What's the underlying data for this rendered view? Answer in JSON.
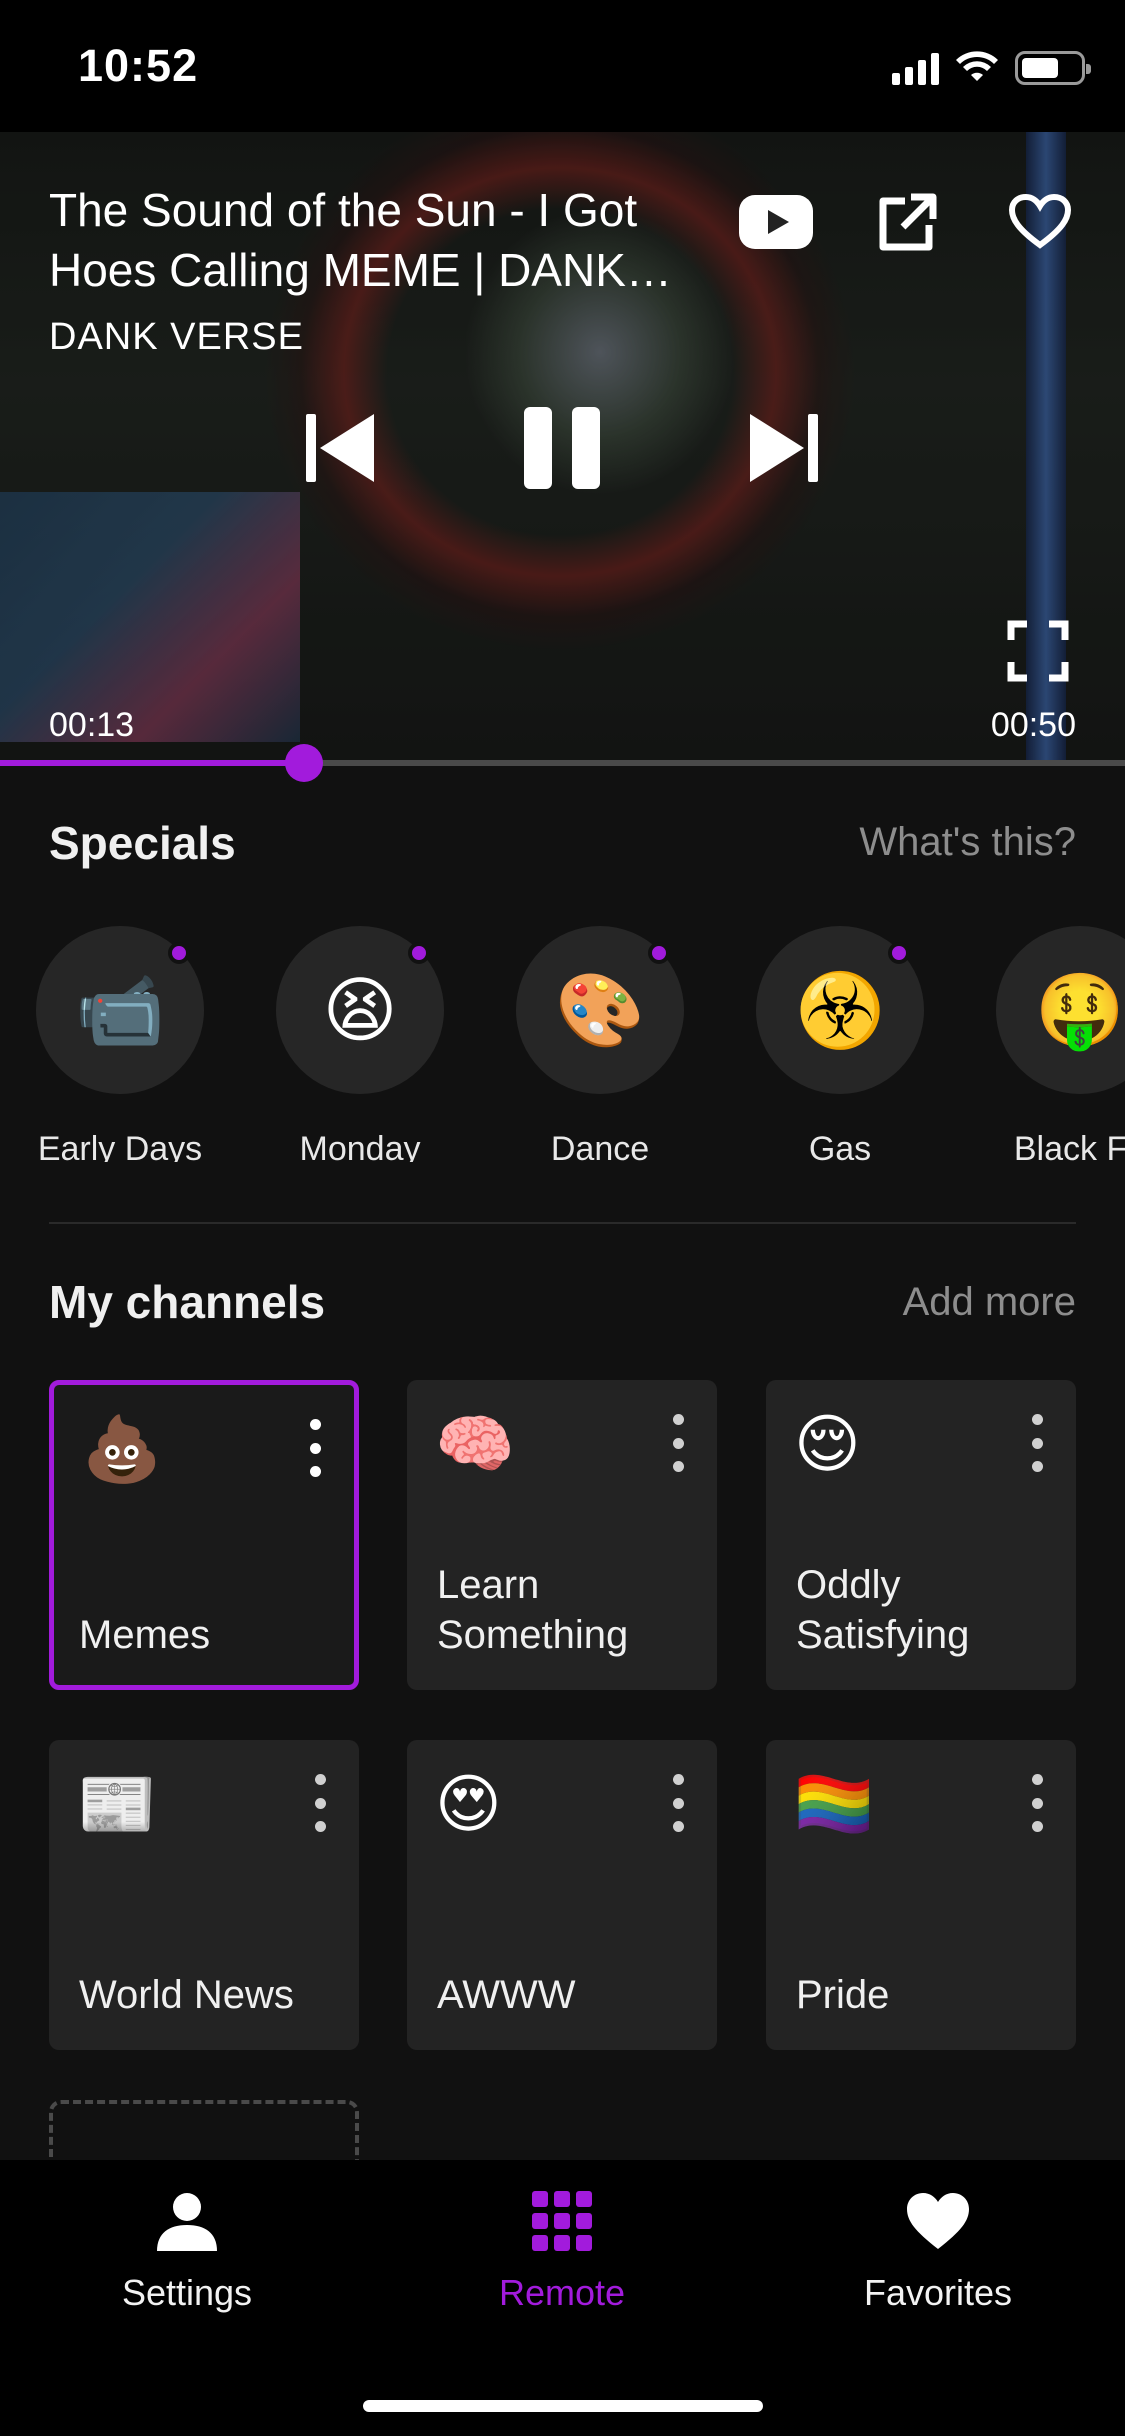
{
  "status_bar": {
    "time": "10:52"
  },
  "player": {
    "title": "The Sound of the Sun - I Got Hoes Calling MEME | DANK VERSE",
    "channel": "DANK VERSE",
    "current_time": "00:13",
    "duration": "00:50",
    "progress_fraction": 0.27
  },
  "specials": {
    "title": "Specials",
    "link": "What's this?",
    "items": [
      {
        "emoji": "📹",
        "label": "Early Days",
        "has_new": true
      },
      {
        "emoji": "😫",
        "label": "Monday",
        "has_new": true
      },
      {
        "emoji": "🎨",
        "label": "Dance",
        "has_new": true
      },
      {
        "emoji": "☣️",
        "label": "Gas",
        "has_new": true
      },
      {
        "emoji": "🤑",
        "label": "Black Fri",
        "has_new": false
      }
    ]
  },
  "channels": {
    "title": "My channels",
    "link": "Add more",
    "items": [
      {
        "emoji": "💩",
        "name": "Memes",
        "selected": true
      },
      {
        "emoji": "🧠",
        "name": "Learn Something",
        "selected": false
      },
      {
        "emoji": "😌",
        "name": "Oddly Satisfying",
        "selected": false
      },
      {
        "emoji": "📰",
        "name": "World News",
        "selected": false
      },
      {
        "emoji": "😍",
        "name": "AWWW",
        "selected": false
      },
      {
        "emoji": "🏳️‍🌈",
        "name": "Pride",
        "selected": false
      }
    ]
  },
  "nav": {
    "items": [
      {
        "label": "Settings",
        "icon": "person-icon",
        "active": false
      },
      {
        "label": "Remote",
        "icon": "grid-icon",
        "active": true
      },
      {
        "label": "Favorites",
        "icon": "heart-icon",
        "active": false
      }
    ]
  },
  "colors": {
    "accent": "#a21bdc",
    "background": "#111111",
    "tile": "#232323",
    "muted_text": "#8d8d8d"
  }
}
